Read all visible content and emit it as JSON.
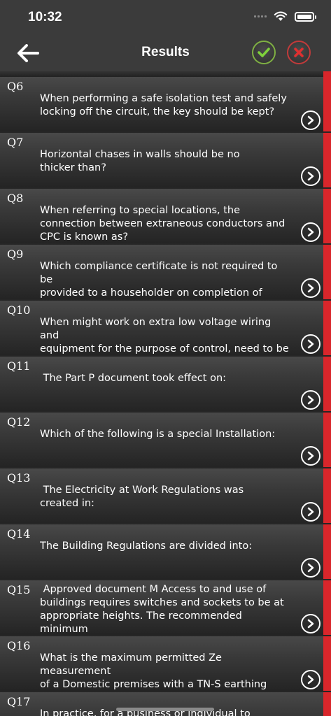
{
  "status_bar": {
    "time": "10:32"
  },
  "header": {
    "title": "Results"
  },
  "colors": {
    "bar_background": "#3b3b3b",
    "accent_red": "#d9262b",
    "correct_green": "#7fb043",
    "wrong_red": "#c23b3b"
  },
  "questions": [
    {
      "label": "Q6",
      "text": "When performing a safe isolation test and safely\nlocking off the circuit, the key should be kept?"
    },
    {
      "label": "Q7",
      "text": "Horizontal chases in walls should be no\nthicker than?"
    },
    {
      "label": "Q8",
      "text": "When referring to special locations, the\nconnection between extraneous conductors and\nCPC is known as?"
    },
    {
      "label": "Q9",
      "text": "Which compliance certificate is not required to be\nprovided to a householder on completion of\nnotifiable work?"
    },
    {
      "label": "Q10",
      "text": "When might work on extra low voltage wiring and\nequipment for the purpose of control, need to be\nnotified to building control. :"
    },
    {
      "label": "Q11",
      "text": " The Part P document took effect on:"
    },
    {
      "label": "Q12",
      "text": "Which of the following is a special Installation:"
    },
    {
      "label": "Q13",
      "text": " The Electricity at Work Regulations was\ncreated in:"
    },
    {
      "label": "Q14",
      "text": "The Building Regulations are divided into:"
    },
    {
      "label": "Q15",
      "text": " Approved document M Access to and use of\nbuildings requires switches and sockets to be at\nappropriate heights. The recommended minimum\nand maximum heights for fixing switches and"
    },
    {
      "label": "Q16",
      "text": "What is the maximum permitted Ze measurement\nof a Domestic premises with a TN-S earthing\nsystem Installed:"
    },
    {
      "label": "Q17",
      "text": "In practice, for a business or individual to become"
    }
  ]
}
